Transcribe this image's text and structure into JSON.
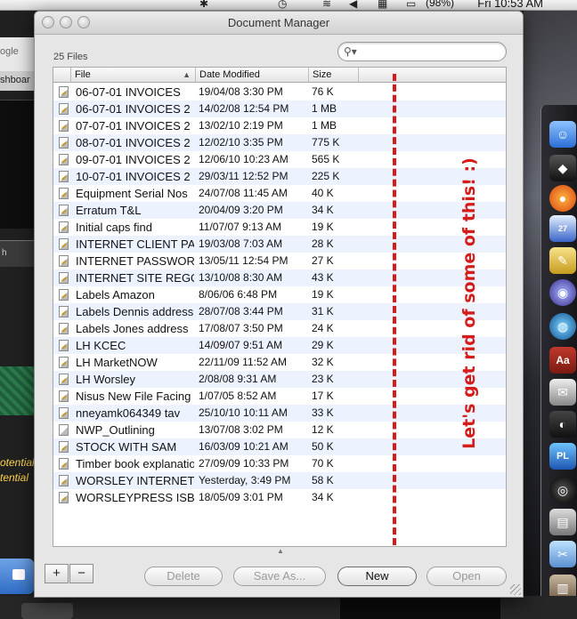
{
  "menubar": {
    "battery": "(98%)",
    "clock": "Fri 10:53 AM"
  },
  "background": {
    "left_tab": "ogle",
    "left_dashboard": "shboar",
    "left_search": "h",
    "left_text": "otential\ntential"
  },
  "dock": {
    "calendar_badge": "27"
  },
  "window": {
    "title": "Document Manager",
    "file_count": "25 Files",
    "search": {
      "placeholder": "",
      "value": ""
    },
    "columns": [
      "File",
      "Date Modified",
      "Size"
    ],
    "rows": [
      {
        "name": "06-07-01 INVOICES",
        "date": "19/04/08 3:30 PM",
        "size": "76 K"
      },
      {
        "name": "06-07-01 INVOICES 2",
        "date": "14/02/08 12:54 PM",
        "size": "1 MB"
      },
      {
        "name": "07-07-01 INVOICES 2",
        "date": "13/02/10 2:19 PM",
        "size": "1 MB"
      },
      {
        "name": "08-07-01 INVOICES 2",
        "date": "12/02/10 3:35 PM",
        "size": "775 K"
      },
      {
        "name": "09-07-01 INVOICES 2",
        "date": "12/06/10 10:23 AM",
        "size": "565 K"
      },
      {
        "name": "10-07-01 INVOICES 2",
        "date": "29/03/11 12:52 PM",
        "size": "225 K"
      },
      {
        "name": "Equipment Serial Nos",
        "date": "24/07/08 11:45 AM",
        "size": "40 K"
      },
      {
        "name": "Erratum T&L",
        "date": "20/04/09 3:20 PM",
        "size": "34 K"
      },
      {
        "name": "Initial caps find",
        "date": "11/07/07 9:13 AM",
        "size": "19 K"
      },
      {
        "name": "INTERNET CLIENT PASS",
        "date": "19/03/08 7:03 AM",
        "size": "28 K"
      },
      {
        "name": "INTERNET PASSWORDS",
        "date": "13/05/11 12:54 PM",
        "size": "27 K"
      },
      {
        "name": "INTERNET SITE REGO,",
        "date": "13/10/08 8:30 AM",
        "size": "43 K"
      },
      {
        "name": "Labels Amazon",
        "date": "8/06/06 6:48 PM",
        "size": "19 K"
      },
      {
        "name": "Labels Dennis address",
        "date": "28/07/08 3:44 PM",
        "size": "31 K"
      },
      {
        "name": "Labels Jones address",
        "date": "17/08/07 3:50 PM",
        "size": "24 K"
      },
      {
        "name": "LH KCEC",
        "date": "14/09/07 9:51 AM",
        "size": "29 K"
      },
      {
        "name": "LH MarketNOW",
        "date": "22/11/09 11:52 AM",
        "size": "32 K"
      },
      {
        "name": "LH Worsley",
        "date": "2/08/08 9:31 AM",
        "size": "23 K"
      },
      {
        "name": "Nisus New File Facing",
        "date": "1/07/05 8:52 AM",
        "size": "17 K"
      },
      {
        "name": "nneyamk064349  tav",
        "date": "25/10/10 10:11 AM",
        "size": "33 K"
      },
      {
        "name": "NWP_Outlining",
        "date": "13/07/08 3:02 PM",
        "size": "12 K",
        "plain": true
      },
      {
        "name": "STOCK WITH SAM",
        "date": "16/03/09 10:21 AM",
        "size": "50 K"
      },
      {
        "name": "Timber book explanation",
        "date": "27/09/09 10:33 PM",
        "size": "70 K"
      },
      {
        "name": "WORSLEY INTERNET",
        "date": "Yesterday, 3:49 PM",
        "size": "58 K"
      },
      {
        "name": "WORSLEYPRESS ISBN I",
        "date": "18/05/09 3:01 PM",
        "size": "34 K"
      }
    ],
    "annotation": "Let's get rid of some of this!  :)",
    "buttons": {
      "add": "+",
      "remove": "−",
      "delete": "Delete",
      "save_as": "Save As...",
      "new": "New",
      "open": "Open"
    },
    "colors": {
      "annotation": "#d61b1b",
      "row_stripe": "#edf3fe"
    }
  }
}
